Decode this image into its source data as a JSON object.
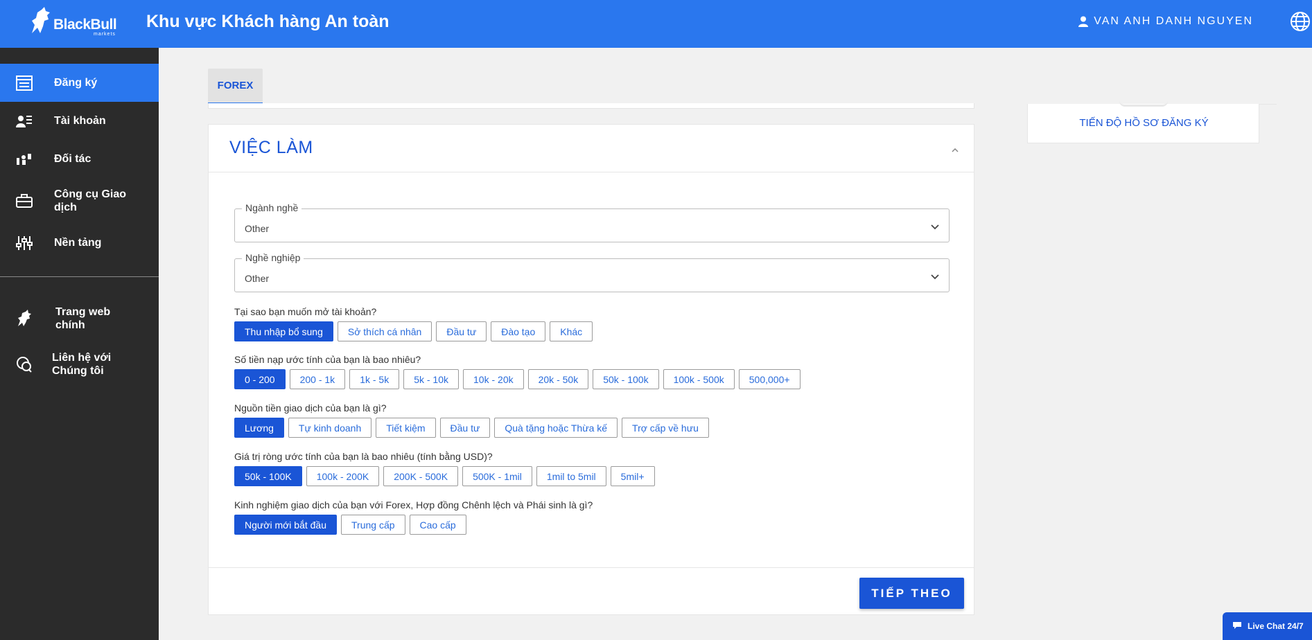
{
  "brand": {
    "name": "BlackBull",
    "sub": "markets"
  },
  "header": {
    "title": "Khu vực Khách hàng An toàn",
    "user_name": "VAN ANH DANH NGUYEN"
  },
  "sidebar": {
    "items": [
      {
        "label": "Đăng ký",
        "icon": "form-icon"
      },
      {
        "label": "Tài khoản",
        "icon": "account-icon"
      },
      {
        "label": "Đối tác",
        "icon": "partner-icon"
      },
      {
        "label": "Công cụ Giao dịch",
        "icon": "briefcase-icon"
      },
      {
        "label": "Nền tảng",
        "icon": "sliders-icon"
      },
      {
        "label": "Trang web chính",
        "icon": "bull-icon"
      },
      {
        "label": "Liên hệ với Chúng tôi",
        "icon": "chat-icon"
      }
    ]
  },
  "tabs": [
    {
      "label": "FOREX"
    }
  ],
  "progress": {
    "label": "TIẾN ĐỘ HỒ SƠ ĐĂNG KÝ"
  },
  "section": {
    "title": "VIỆC LÀM",
    "industry": {
      "label": "Ngành nghề",
      "value": "Other"
    },
    "occupation": {
      "label": "Nghề nghiệp",
      "value": "Other"
    },
    "questions": [
      {
        "text": "Tại sao bạn muốn mở tài khoản?",
        "options": [
          "Thu nhập bổ sung",
          "Sở thích cá nhân",
          "Đầu tư",
          "Đào tạo",
          "Khác"
        ],
        "selected": 0
      },
      {
        "text": "Số tiền nạp ước tính của bạn là bao nhiêu?",
        "options": [
          "0 - 200",
          "200 - 1k",
          "1k - 5k",
          "5k - 10k",
          "10k - 20k",
          "20k - 50k",
          "50k - 100k",
          "100k - 500k",
          "500,000+"
        ],
        "selected": 0
      },
      {
        "text": "Nguồn tiền giao dịch của bạn là gì?",
        "options": [
          "Lương",
          "Tự kinh doanh",
          "Tiết kiệm",
          "Đầu tư",
          "Quà tặng hoặc Thừa kế",
          "Trợ cấp về hưu"
        ],
        "selected": 0
      },
      {
        "text": "Giá trị ròng ước tính của bạn là bao nhiêu (tính bằng USD)?",
        "options": [
          "50k - 100K",
          "100k - 200K",
          "200K - 500K",
          "500K - 1mil",
          "1mil to 5mil",
          "5mil+"
        ],
        "selected": 0
      },
      {
        "text": "Kinh nghiệm giao dịch của bạn với Forex, Hợp đồng Chênh lệch và Phái sinh là gì?",
        "options": [
          "Người mới bắt đầu",
          "Trung cấp",
          "Cao cấp"
        ],
        "selected": 0
      }
    ],
    "next_label": "TIẾP THEO"
  },
  "livechat": {
    "label": "Live Chat 24/7"
  },
  "colors": {
    "primary": "#2a77ee",
    "accent": "#1a55d6",
    "sidebar": "#2b2b2b"
  }
}
